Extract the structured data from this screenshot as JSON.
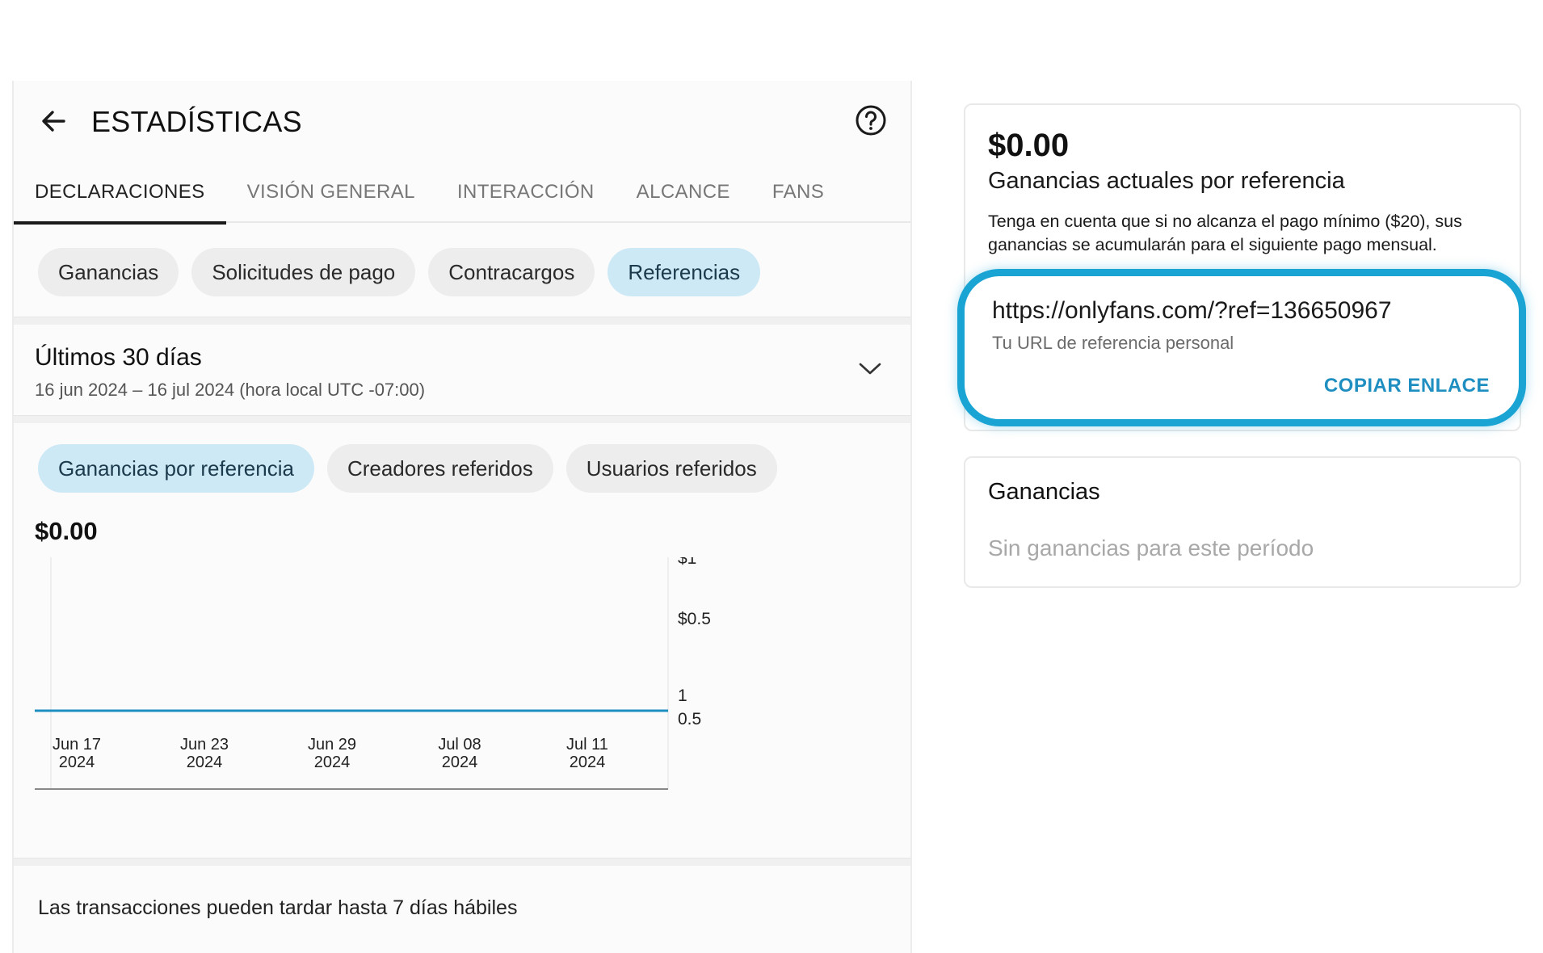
{
  "header": {
    "title": "ESTADÍSTICAS",
    "back_icon": "arrow-left-icon",
    "help_icon": "question-circle-icon"
  },
  "main_tabs": [
    {
      "label": "DECLARACIONES",
      "active": true
    },
    {
      "label": "VISIÓN GENERAL",
      "active": false
    },
    {
      "label": "INTERACCIÓN",
      "active": false
    },
    {
      "label": "ALCANCE",
      "active": false
    },
    {
      "label": "FANS",
      "active": false
    }
  ],
  "sub_tabs": [
    {
      "label": "Ganancias",
      "active": false
    },
    {
      "label": "Solicitudes de pago",
      "active": false
    },
    {
      "label": "Contracargos",
      "active": false
    },
    {
      "label": "Referencias",
      "active": true
    }
  ],
  "period": {
    "title": "Últimos 30 días",
    "range": "16 jun 2024 – 16 jul 2024 (hora local UTC -07:00)"
  },
  "chart_tabs": [
    {
      "label": "Ganancias por referencia",
      "active": true
    },
    {
      "label": "Creadores referidos",
      "active": false
    },
    {
      "label": "Usuarios referidos",
      "active": false
    }
  ],
  "chart_total": "$0.00",
  "chart_data": {
    "type": "line",
    "x": [
      "Jun 17 2024",
      "Jun 23 2024",
      "Jun 29 2024",
      "Jul 08 2024",
      "Jul 11 2024"
    ],
    "x_tick_labels": [
      [
        "Jun 17",
        "2024"
      ],
      [
        "Jun 23",
        "2024"
      ],
      [
        "Jun 29",
        "2024"
      ],
      [
        "Jul 08",
        "2024"
      ],
      [
        "Jul 11",
        "2024"
      ]
    ],
    "series": [
      {
        "values": [
          0,
          0,
          0,
          0,
          0
        ],
        "color": "#1f8ec0"
      }
    ],
    "y_tick_labels_upper": [
      "$1",
      "$0.5"
    ],
    "y_tick_labels_lower": [
      "1",
      "0.5"
    ],
    "grid": false
  },
  "footnote": "Las transacciones pueden tardar hasta 7 días hábiles",
  "referral_card": {
    "amount": "$0.00",
    "amount_label": "Ganancias actuales por referencia",
    "note": "Tenga en cuenta que si no alcanza el pago mínimo ($20), sus ganancias se acumularán para el siguiente pago mensual.",
    "url": "https://onlyfans.com/?ref=136650967",
    "url_label": "Tu URL de referencia personal",
    "copy_label": "COPIAR ENLACE",
    "highlight_color": "#19a4d4"
  },
  "earnings_card": {
    "title": "Ganancias",
    "empty_text": "Sin ganancias para este período"
  }
}
